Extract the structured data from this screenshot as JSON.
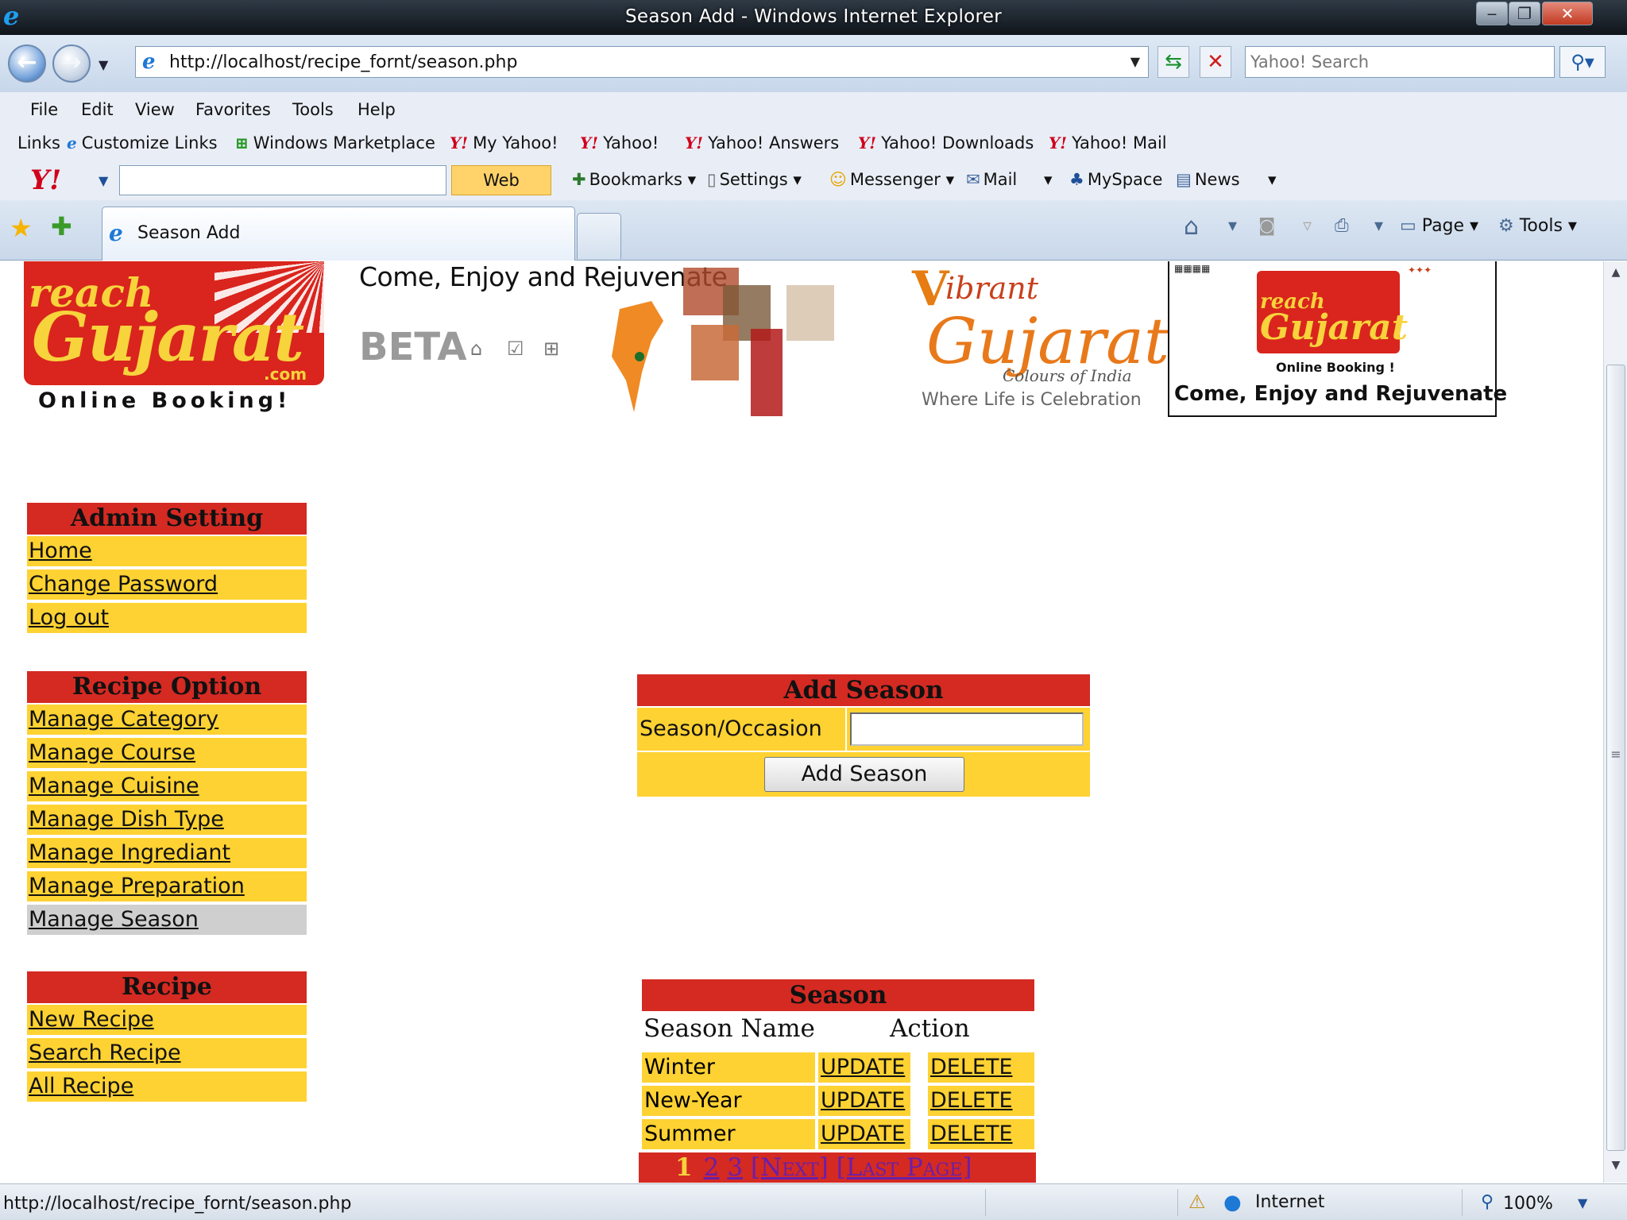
{
  "window": {
    "title": "Season Add - Windows Internet Explorer",
    "min_glyph": "‒",
    "max_glyph": "❐",
    "close_glyph": "✕"
  },
  "address_bar": {
    "url": "http://localhost/recipe_fornt/season.php",
    "search_placeholder": "Yahoo! Search"
  },
  "menu": [
    "File",
    "Edit",
    "View",
    "Favorites",
    "Tools",
    "Help"
  ],
  "links_bar": {
    "label": "Links",
    "items": [
      "Customize Links",
      "Windows Marketplace",
      "My Yahoo!",
      "Yahoo!",
      "Yahoo! Answers",
      "Yahoo! Downloads",
      "Yahoo! Mail"
    ]
  },
  "yahoo_toolbar": {
    "logo": "Y!",
    "search_button": "Web Search",
    "items": [
      "Bookmarks",
      "Settings",
      "Messenger",
      "Mail",
      "MySpace",
      "News"
    ]
  },
  "tabs": {
    "active_label": "Season Add"
  },
  "command_bar": {
    "page": "Page",
    "tools": "Tools"
  },
  "banner": {
    "logo_reach": "reach",
    "logo_gujarat": "Gujarat",
    "logo_com": ".com",
    "logo_tagline": "Online Booking!",
    "tagline": "Come, Enjoy and Rejuvenate",
    "beta": "BETA",
    "vibrant_v": "V",
    "vibrant_ibrant": "ibrant",
    "vibrant_gujarat": "Gujarat",
    "vibrant_colours": "Colours of India",
    "vibrant_where": "Where Life is Celebration",
    "ad_reach": "reach",
    "ad_gujarat": "Gujarat",
    "ad_online": "Online Booking !",
    "ad_tagline": "Come, Enjoy and Rejuvenate"
  },
  "sidebar": {
    "admin": {
      "title": "Admin Setting",
      "items": [
        "Home",
        "Change Password",
        "Log out"
      ]
    },
    "recipe_option": {
      "title": "Recipe Option",
      "items": [
        "Manage Category",
        "Manage Course",
        "Manage Cuisine",
        "Manage Dish Type",
        "Manage Ingrediant",
        "Manage Preparation",
        "Manage Season"
      ],
      "active": "Manage Season"
    },
    "recipe": {
      "title": "Recipe",
      "items": [
        "New Recipe",
        "Search Recipe",
        "All Recipe"
      ]
    }
  },
  "add_form": {
    "title": "Add Season",
    "field_label": "Season/Occasion",
    "field_value": "",
    "button_label": "Add Season"
  },
  "season_table": {
    "title": "Season",
    "columns": [
      "Season Name",
      "Action"
    ],
    "rows": [
      {
        "name": "Winter",
        "update": "UPDATE",
        "delete": "DELETE"
      },
      {
        "name": "New-Year",
        "update": "UPDATE",
        "delete": "DELETE"
      },
      {
        "name": "Summer",
        "update": "UPDATE",
        "delete": "DELETE"
      }
    ],
    "pager": {
      "current": "1",
      "pages": [
        "2",
        "3"
      ],
      "next": "[Next]",
      "last": "[Last Page]"
    }
  },
  "status_bar": {
    "url": "http://localhost/recipe_fornt/season.php",
    "zone": "Internet",
    "zoom": "100%"
  }
}
